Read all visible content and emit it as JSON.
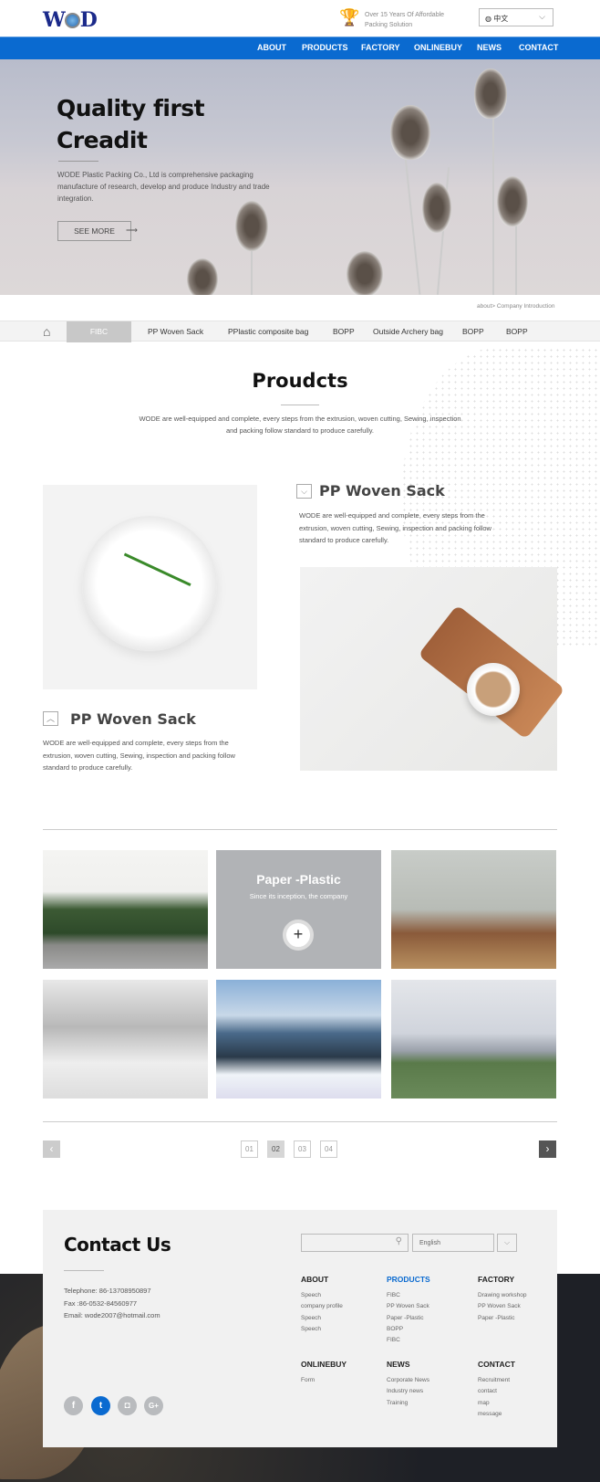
{
  "header": {
    "logo": "WOD",
    "tagline": [
      "Over 15 Years Of Affordable",
      "Packing Solution"
    ],
    "language": "中文",
    "icons": {
      "trophy": "trophy-icon",
      "globe": "globe-icon"
    }
  },
  "nav": [
    "ABOUT",
    "PRODUCTS",
    "FACTORY",
    "ONLINEBUY",
    "NEWS",
    "CONTACT"
  ],
  "colors": {
    "brand": "#0a6ad0",
    "active_tab": "#c8c8c8"
  },
  "hero": {
    "title_line1": "Quality first",
    "title_line2": "Creadit",
    "text": "WODE Plastic Packing Co., Ltd is comprehensive packaging manufacture of research, develop and produce Industry and trade integration.",
    "button": "SEE MORE"
  },
  "breadcrumb": "about>  Company Introduction",
  "subnav": {
    "active": "FIBC",
    "items": [
      "FIBC",
      "PP Woven Sack",
      "PPlastic composite bag",
      "BOPP",
      "Outside Archery bag",
      "BOPP",
      "BOPP"
    ]
  },
  "products": {
    "title": "Proudcts",
    "text": "WODE are well-equipped and complete, every steps from the extrusion, woven cutting, Sewing, inspection and packing follow standard to produce carefully.",
    "items": [
      {
        "title": "PP Woven Sack",
        "text": "WODE are well-equipped and complete, every steps from the extrusion, woven cutting, Sewing, inspection and packing follow standard to produce carefully."
      },
      {
        "title": "PP Woven Sack",
        "text": "WODE are well-equipped and complete, every steps from the extrusion, woven cutting, Sewing, inspection and packing follow standard to produce carefully."
      }
    ]
  },
  "gallery": {
    "featured_title": "Paper -Plastic",
    "featured_text": "Since its inception, the company",
    "pages": [
      "01",
      "02",
      "03",
      "04"
    ],
    "current_page": "02"
  },
  "footer": {
    "title": "Contact Us",
    "telephone": "Telephone: 86-13708950897",
    "fax": "Fax :86-0532-84560977",
    "email": "Email: wode2007@hotmail.com",
    "search_placeholder": "",
    "language": "English",
    "columns": [
      {
        "title": "ABOUT",
        "links": [
          "Speech",
          "company profile",
          "Speech",
          "Speech"
        ]
      },
      {
        "title": "PRODUCTS",
        "links": [
          "FIBC",
          "PP Woven Sack",
          "Paper -Plastic",
          "BOPP",
          "FIBC"
        ]
      },
      {
        "title": "FACTORY",
        "links": [
          "Drawing workshop",
          "PP Woven Sack",
          "Paper -Plastic"
        ]
      },
      {
        "title": "ONLINEBUY",
        "links": [
          "Form"
        ]
      },
      {
        "title": "NEWS",
        "links": [
          "Corporate News",
          "Industry news",
          "Training"
        ]
      },
      {
        "title": "CONTACT",
        "links": [
          "Recruitment",
          "contact",
          "map",
          "message"
        ]
      }
    ],
    "social": [
      "facebook",
      "twitter",
      "instagram",
      "google-plus"
    ]
  }
}
